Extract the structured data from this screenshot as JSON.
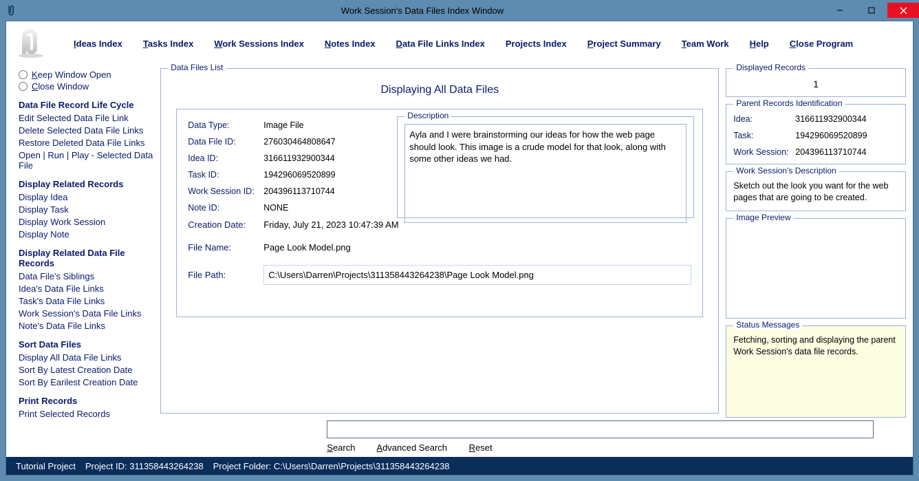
{
  "window": {
    "title": "Work Session's Data Files Index Window"
  },
  "menu": {
    "ideas": "Ideas Index",
    "tasks": "Tasks Index",
    "work_sessions": "Work Sessions Index",
    "notes": "Notes Index",
    "data_file_links": "Data File Links Index",
    "projects_index": "Projects Index",
    "project_summary": "Project Summary",
    "team_work": "Team Work",
    "help": "Help",
    "close_program": "Close Program"
  },
  "sidebar": {
    "keep_open": "Keep Window Open",
    "close_window": "Close Window",
    "groups": {
      "lifecycle": {
        "title": "Data File Record Life Cycle",
        "edit": "Edit Selected Data File Link",
        "delete": "Delete Selected Data File Links",
        "restore": "Restore Deleted Data File Links",
        "openrun": "Open | Run | Play - Selected Data File"
      },
      "related": {
        "title": "Display Related Records",
        "idea": "Display Idea",
        "task": "Display Task",
        "ws": "Display Work Session",
        "note": "Display Note"
      },
      "related_df": {
        "title": "Display Related Data File Records",
        "siblings": "Data File's Siblings",
        "idea_links": "Idea's Data File Links",
        "task_links": "Task's Data File Links",
        "ws_links": "Work Session's Data File Links",
        "note_links": "Note's Data File Links"
      },
      "sort": {
        "title": "Sort Data Files",
        "all": "Display All Data File Links",
        "latest": "Sort By Latest Creation Date",
        "earliest": "Sort By Earilest Creation Date"
      },
      "print": {
        "title": "Print Records",
        "sel": "Print Selected Records"
      }
    }
  },
  "data_files_list": {
    "group_title": "Data Files List",
    "heading": "Displaying All Data Files",
    "labels": {
      "data_type": "Data Type:",
      "data_file_id": "Data File ID:",
      "idea_id": "Idea ID:",
      "task_id": "Task ID:",
      "ws_id": "Work Session ID:",
      "note_id": "Note ID:",
      "creation_date": "Creation Date:",
      "file_name": "File Name:",
      "file_path": "File Path:",
      "description": "Description"
    },
    "values": {
      "data_type": "Image File",
      "data_file_id": "276030464808647",
      "idea_id": "316611932900344",
      "task_id": "194296069520899",
      "ws_id": "204396113710744",
      "note_id": "NONE",
      "creation_date": "Friday, July 21, 2023   10:47:39 AM",
      "file_name": "Page Look Model.png",
      "file_path": "C:\\Users\\Darren\\Projects\\311358443264238\\Page Look Model.png",
      "description": "Ayla and I were brainstorming our ideas for how the web page should look. This image is a crude model for that look, along with some other ideas we had."
    }
  },
  "search": {
    "value": "",
    "search": "Search",
    "advanced": "Advanced Search",
    "reset": "Reset"
  },
  "right": {
    "displayed_records": {
      "title": "Displayed Records",
      "value": "1"
    },
    "parent_ids": {
      "title": "Parent Records Identification",
      "idea_l": "Idea:",
      "idea_v": "316611932900344",
      "task_l": "Task:",
      "task_v": "194296069520899",
      "ws_l": "Work Session:",
      "ws_v": "204396113710744"
    },
    "ws_desc": {
      "title": "Work Session's Description",
      "text": "Sketch out the look you want for the web pages that are going to be created."
    },
    "image_preview": {
      "title": "Image Preview"
    },
    "status": {
      "title": "Status Messages",
      "text": "Fetching, sorting and displaying the parent Work Session's data file records."
    }
  },
  "statusbar": {
    "project_name": "Tutorial Project",
    "project_id": "Project ID:  311358443264238",
    "project_folder": "Project Folder:  C:\\Users\\Darren\\Projects\\311358443264238"
  }
}
